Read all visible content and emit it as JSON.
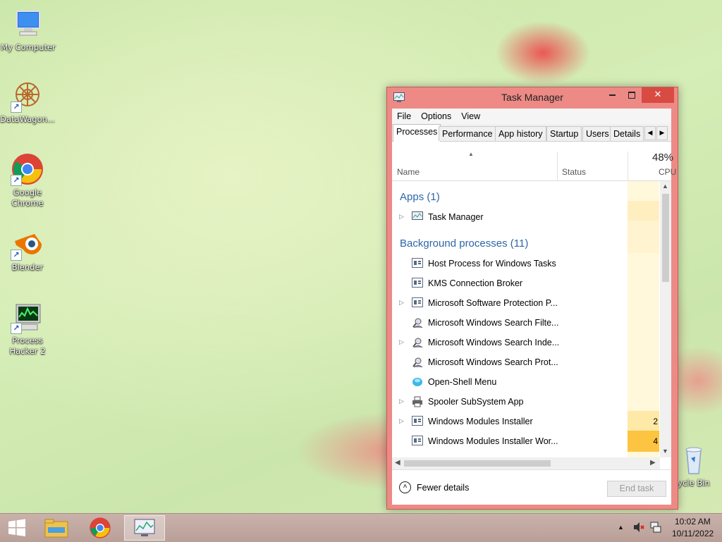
{
  "desktop_icons": [
    {
      "label": "My Computer",
      "icon": "computer-icon"
    },
    {
      "label": "DataWagon...",
      "icon": "datawagon-icon"
    },
    {
      "label": "Google Chrome",
      "icon": "chrome-icon"
    },
    {
      "label": "Blender",
      "icon": "blender-icon"
    },
    {
      "label": "Process Hacker 2",
      "icon": "process-hacker-icon"
    },
    {
      "label": "ycle Bin",
      "icon": "recycle-bin-icon"
    }
  ],
  "task_manager": {
    "title": "Task Manager",
    "menu": [
      "File",
      "Options",
      "View"
    ],
    "tabs": [
      "Processes",
      "Performance",
      "App history",
      "Startup",
      "Users",
      "Details"
    ],
    "active_tab": "Processes",
    "columns": {
      "name": "Name",
      "status": "Status",
      "cpu_percent": "48%",
      "cpu": "CPU"
    },
    "groups": [
      {
        "label": "Apps (1)",
        "items": [
          {
            "name": "Task Manager",
            "expandable": true,
            "icon": "task-manager-icon",
            "cpu": ""
          }
        ]
      },
      {
        "label": "Background processes (11)",
        "items": [
          {
            "name": "Host Process for Windows Tasks",
            "expandable": false,
            "icon": "process-icon",
            "cpu": ""
          },
          {
            "name": "KMS Connection Broker",
            "expandable": false,
            "icon": "process-icon",
            "cpu": ""
          },
          {
            "name": "Microsoft Software Protection P...",
            "expandable": true,
            "icon": "process-icon",
            "cpu": ""
          },
          {
            "name": "Microsoft Windows Search Filte...",
            "expandable": false,
            "icon": "search-user-icon",
            "cpu": ""
          },
          {
            "name": "Microsoft Windows Search Inde...",
            "expandable": true,
            "icon": "search-user-icon",
            "cpu": ""
          },
          {
            "name": "Microsoft Windows Search Prot...",
            "expandable": false,
            "icon": "search-user-icon",
            "cpu": ""
          },
          {
            "name": "Open-Shell Menu",
            "expandable": false,
            "icon": "shell-icon",
            "cpu": ""
          },
          {
            "name": "Spooler SubSystem App",
            "expandable": true,
            "icon": "printer-icon",
            "cpu": ""
          },
          {
            "name": "Windows Modules Installer",
            "expandable": true,
            "icon": "process-icon",
            "cpu": "2"
          },
          {
            "name": "Windows Modules Installer Wor...",
            "expandable": false,
            "icon": "process-icon",
            "cpu": "4"
          }
        ]
      }
    ],
    "fewer_details": "Fewer details",
    "end_task": "End task"
  },
  "taskbar": {
    "pinned": [
      "start-icon",
      "file-explorer-icon",
      "chrome-icon",
      "task-manager-icon"
    ],
    "time": "10:02 AM",
    "date": "10/11/2022"
  }
}
